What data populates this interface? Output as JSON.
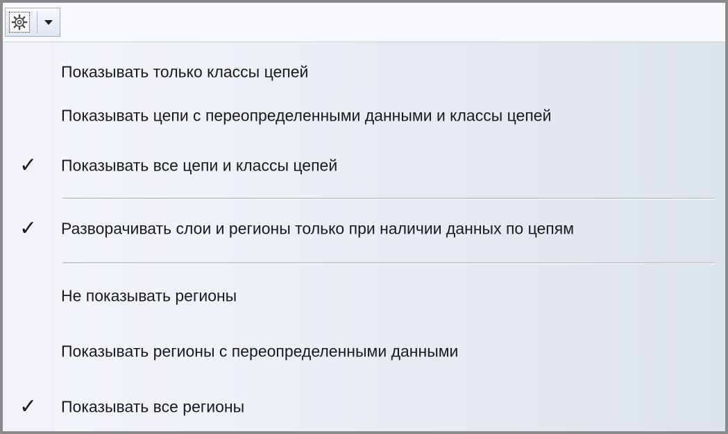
{
  "toolbar": {
    "settings_button_icon": "gear-icon",
    "dropdown_icon": "chevron-down-icon"
  },
  "menu": {
    "items": [
      {
        "label": "Показывать только классы цепей",
        "checked": false
      },
      {
        "label": "Показывать цепи с переопределенными данными и классы цепей",
        "checked": false
      },
      {
        "label": "Показывать все цепи и классы цепей",
        "checked": true
      },
      {
        "label": "Разворачивать слои и регионы только при наличии данных по цепям",
        "checked": true
      },
      {
        "label": "Не показывать регионы",
        "checked": false
      },
      {
        "label": "Показывать регионы с переопределенными данными",
        "checked": false
      },
      {
        "label": "Показывать все регионы",
        "checked": true
      }
    ],
    "check_glyph": "✓"
  }
}
